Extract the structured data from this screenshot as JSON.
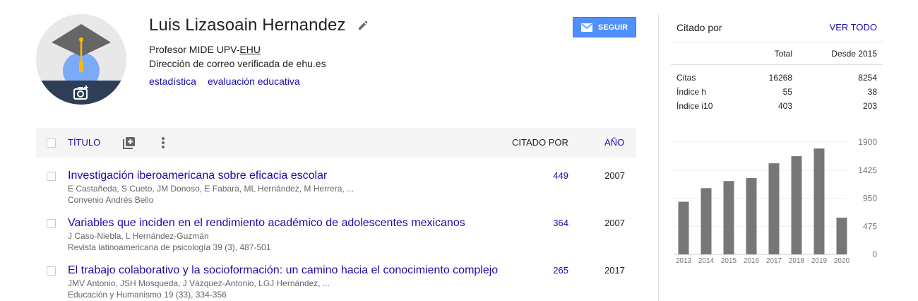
{
  "profile": {
    "name": "Luis Lizasoain Hernandez",
    "affiliation_prefix": "Profesor MIDE UPV-",
    "affiliation_org": "EHU",
    "email_verified": "Dirección de correo verificada de ehu.es",
    "interests": [
      "estadística",
      "evaluación educativa"
    ],
    "follow_label": "SEGUIR"
  },
  "table": {
    "title_header": "TÍTULO",
    "cited_header": "CITADO POR",
    "year_header": "AÑO",
    "rows": [
      {
        "title": "Investigación iberoamericana sobre eficacia escolar",
        "authors": "E Castañeda, S Cueto, JM Donoso, E Fabara, ML Hernández, M Herrera, ...",
        "venue": "Convenio Andrés Bello",
        "cited": "449",
        "year": "2007"
      },
      {
        "title": "Variables que inciden en el rendimiento académico de adolescentes mexicanos",
        "authors": "J Caso-Niebla, L Hernández-Guzmán",
        "venue": "Revista latinoamericana de psicología 39 (3), 487-501",
        "cited": "364",
        "year": "2007"
      },
      {
        "title": "El trabajo colaborativo y la socioformación: un camino hacia el conocimiento complejo",
        "authors": "JMV Antonio, JSH Mosqueda, J Vázquez-Antonio, LGJ Hernández, ...",
        "venue": "Educación y Humanismo 19 (33), 334-356",
        "cited": "265",
        "year": "2017"
      }
    ]
  },
  "cited_by": {
    "title": "Citado por",
    "view_all": "VER TODO",
    "col_total": "Total",
    "col_since": "Desde 2015",
    "rows": [
      {
        "label": "Citas",
        "total": "16268",
        "since": "8254"
      },
      {
        "label": "Índice h",
        "total": "55",
        "since": "38"
      },
      {
        "label": "Índice i10",
        "total": "403",
        "since": "203"
      }
    ]
  },
  "chart_data": {
    "type": "bar",
    "categories": [
      "2013",
      "2014",
      "2015",
      "2016",
      "2017",
      "2018",
      "2019",
      "2020"
    ],
    "values": [
      890,
      1120,
      1240,
      1290,
      1540,
      1660,
      1790,
      620
    ],
    "ylim": [
      0,
      1900
    ],
    "yticks": [
      0,
      475,
      950,
      1425,
      1900
    ],
    "grid": true,
    "bar_color": "#777777"
  },
  "colors": {
    "link": "#1a0dab",
    "button": "#4d90fe"
  },
  "icons": {
    "avatar": "graduation-cap-avatar",
    "camera": "add-photo-icon",
    "edit": "pencil-icon",
    "mail": "mail-icon",
    "add": "add-box-icon",
    "more": "more-vert-icon"
  }
}
